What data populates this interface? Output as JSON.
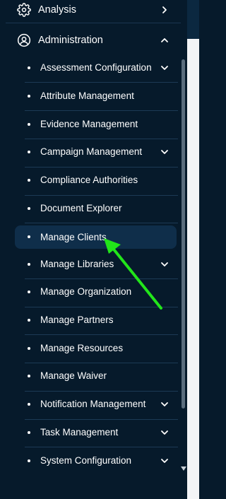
{
  "nav": {
    "analysis": {
      "label": "Analysis",
      "icon": "gear-icon"
    },
    "administration": {
      "label": "Administration",
      "icon": "user-circle-icon"
    }
  },
  "subitems": [
    {
      "label": "Assessment Configuration",
      "has_children": true
    },
    {
      "label": "Attribute Management",
      "has_children": false
    },
    {
      "label": "Evidence Management",
      "has_children": false
    },
    {
      "label": "Campaign Management",
      "has_children": true
    },
    {
      "label": "Compliance Authorities",
      "has_children": false
    },
    {
      "label": "Document Explorer",
      "has_children": false
    },
    {
      "label": "Manage Clients",
      "has_children": false,
      "active": true
    },
    {
      "label": "Manage Libraries",
      "has_children": true
    },
    {
      "label": "Manage Organization",
      "has_children": false
    },
    {
      "label": "Manage Partners",
      "has_children": false
    },
    {
      "label": "Manage Resources",
      "has_children": false
    },
    {
      "label": "Manage Waiver",
      "has_children": false
    },
    {
      "label": "Notification Management",
      "has_children": true
    },
    {
      "label": "Task Management",
      "has_children": true
    },
    {
      "label": "System Configuration",
      "has_children": true
    }
  ],
  "colors": {
    "sidebar_bg": "#061a2b",
    "active_bg": "#0f2e4a",
    "annotation_arrow": "#22e51a"
  }
}
